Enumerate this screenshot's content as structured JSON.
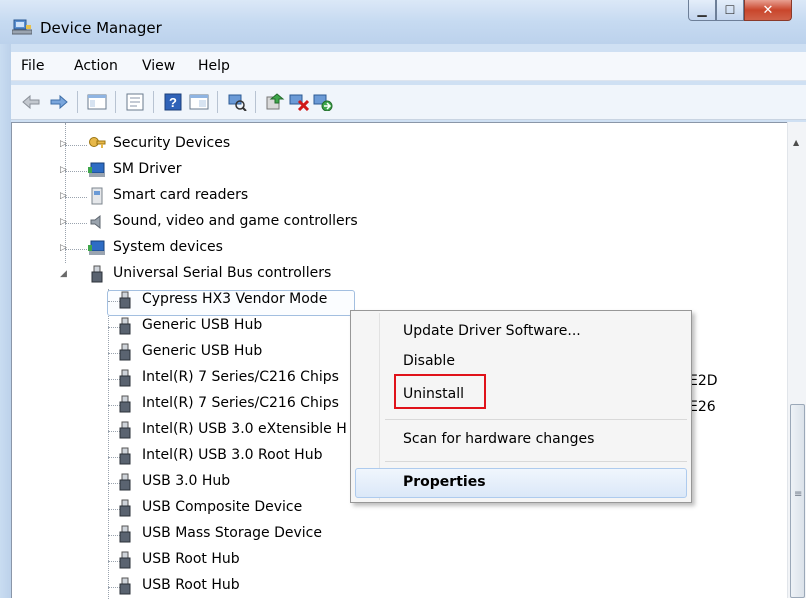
{
  "window": {
    "title": "Device Manager",
    "controls": [
      "minimize-icon",
      "maximize-icon",
      "close-icon"
    ]
  },
  "menu": [
    "File",
    "Action",
    "View",
    "Help"
  ],
  "toolbar_icons": [
    "back-arrow-icon",
    "forward-arrow-icon",
    "show-hide-console-tree-icon",
    "properties-icon",
    "help-icon",
    "console-tree-icon",
    "scan-hardware-icon",
    "update-driver-icon",
    "uninstall-icon",
    "enable-icon"
  ],
  "tree": {
    "collapsed": [
      {
        "label": "Security Devices",
        "icon": "key-icon"
      },
      {
        "label": "SM Driver",
        "icon": "computer-icon"
      },
      {
        "label": "Smart card readers",
        "icon": "smart-card-icon"
      },
      {
        "label": "Sound, video and game controllers",
        "icon": "speaker-icon"
      },
      {
        "label": "System devices",
        "icon": "computer-icon"
      }
    ],
    "expanded": {
      "label": "Universal Serial Bus controllers",
      "icon": "usb-icon"
    },
    "children": [
      "Cypress HX3 Vendor Mode",
      "Generic USB Hub",
      "Generic USB Hub",
      "Intel(R) 7 Series/C216 Chips",
      "Intel(R) 7 Series/C216 Chips",
      "Intel(R) USB 3.0 eXtensible H",
      "Intel(R) USB 3.0 Root Hub",
      "USB 3.0 Hub",
      "USB Composite Device",
      "USB Mass Storage Device",
      "USB Root Hub",
      "USB Root Hub"
    ],
    "truncated_suffixes": [
      "E2D",
      "E26"
    ]
  },
  "context_menu": {
    "items": [
      "Update Driver Software...",
      "Disable",
      "Uninstall",
      "Scan for hardware changes",
      "Properties"
    ],
    "highlighted": "Uninstall",
    "highlight_color": "#e0121a"
  }
}
